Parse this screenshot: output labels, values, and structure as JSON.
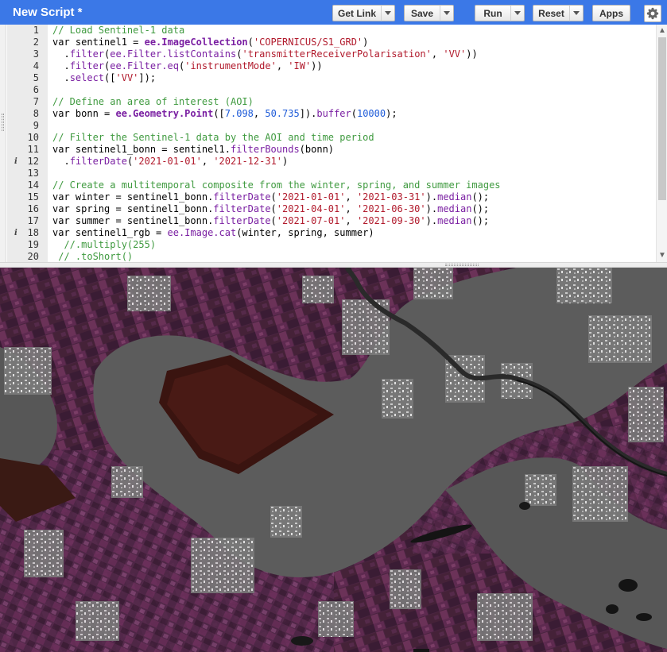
{
  "header": {
    "title": "New Script *",
    "buttons": {
      "get_link": "Get Link",
      "save": "Save",
      "run": "Run",
      "reset": "Reset",
      "apps": "Apps"
    }
  },
  "editor": {
    "lines": [
      {
        "num": "1",
        "info": false
      },
      {
        "num": "2",
        "info": false
      },
      {
        "num": "3",
        "info": false
      },
      {
        "num": "4",
        "info": false
      },
      {
        "num": "5",
        "info": false
      },
      {
        "num": "6",
        "info": false
      },
      {
        "num": "7",
        "info": false
      },
      {
        "num": "8",
        "info": false
      },
      {
        "num": "9",
        "info": false
      },
      {
        "num": "10",
        "info": false
      },
      {
        "num": "11",
        "info": false
      },
      {
        "num": "12",
        "info": true
      },
      {
        "num": "13",
        "info": false
      },
      {
        "num": "14",
        "info": false
      },
      {
        "num": "15",
        "info": false
      },
      {
        "num": "16",
        "info": false
      },
      {
        "num": "17",
        "info": false
      },
      {
        "num": "18",
        "info": true
      },
      {
        "num": "19",
        "info": false
      },
      {
        "num": "20",
        "info": false
      }
    ],
    "info_marker": "i",
    "code": {
      "l1": "// Load Sentinel-1 data",
      "l2_a": "var sentinel1 = ",
      "l2_b": "ee.ImageCollection",
      "l2_c": "(",
      "l2_d": "'COPERNICUS/S1_GRD'",
      "l2_e": ")",
      "l3_a": "  .",
      "l3_b": "filter",
      "l3_c": "(",
      "l3_d": "ee.Filter.listContains",
      "l3_e": "(",
      "l3_f": "'transmitterReceiverPolarisation'",
      "l3_g": ", ",
      "l3_h": "'VV'",
      "l3_i": "))",
      "l4_a": "  .",
      "l4_b": "filter",
      "l4_c": "(",
      "l4_d": "ee.Filter.eq",
      "l4_e": "(",
      "l4_f": "'instrumentMode'",
      "l4_g": ", ",
      "l4_h": "'IW'",
      "l4_i": "))",
      "l5_a": "  .",
      "l5_b": "select",
      "l5_c": "([",
      "l5_d": "'VV'",
      "l5_e": "]);",
      "l7": "// Define an area of interest (AOI)",
      "l8_a": "var bonn = ",
      "l8_b": "ee.Geometry.Point",
      "l8_c": "([",
      "l8_d": "7.098",
      "l8_e": ", ",
      "l8_f": "50.735",
      "l8_g": "]).",
      "l8_h": "buffer",
      "l8_i": "(",
      "l8_j": "10000",
      "l8_k": ");",
      "l10": "// Filter the Sentinel-1 data by the AOI and time period",
      "l11_a": "var sentinel1_bonn = sentinel1.",
      "l11_b": "filterBounds",
      "l11_c": "(bonn)",
      "l12_a": "  .",
      "l12_b": "filterDate",
      "l12_c": "(",
      "l12_d": "'2021-01-01'",
      "l12_e": ", ",
      "l12_f": "'2021-12-31'",
      "l12_g": ")",
      "l14": "// Create a multitemporal composite from the winter, spring, and summer images",
      "l15_a": "var winter = sentinel1_bonn.",
      "l15_b": "filterDate",
      "l15_c": "(",
      "l15_d": "'2021-01-01'",
      "l15_e": ", ",
      "l15_f": "'2021-03-31'",
      "l15_g": ").",
      "l15_h": "median",
      "l15_i": "();",
      "l16_a": "var spring = sentinel1_bonn.",
      "l16_b": "filterDate",
      "l16_c": "(",
      "l16_d": "'2021-04-01'",
      "l16_e": ", ",
      "l16_f": "'2021-06-30'",
      "l16_g": ").",
      "l16_h": "median",
      "l16_i": "();",
      "l17_a": "var summer = sentinel1_bonn.",
      "l17_b": "filterDate",
      "l17_c": "(",
      "l17_d": "'2021-07-01'",
      "l17_e": ", ",
      "l17_f": "'2021-09-30'",
      "l17_g": ").",
      "l17_h": "median",
      "l17_i": "();",
      "l18_a": "var sentinel1_rgb = ",
      "l18_b": "ee.Image.cat",
      "l18_c": "(winter, spring, summer)",
      "l19": "  //.multiply(255)",
      "l20": " // .toShort()"
    }
  },
  "colors": {
    "title_bar": "#3b78e7",
    "comment": "#3f9a3f",
    "string": "#b11a2c",
    "method": "#7a1fa2",
    "number": "#1e5bd8"
  },
  "icons": {
    "settings": "gear-icon",
    "dropdown": "chevron-down-icon",
    "info": "info-icon"
  }
}
